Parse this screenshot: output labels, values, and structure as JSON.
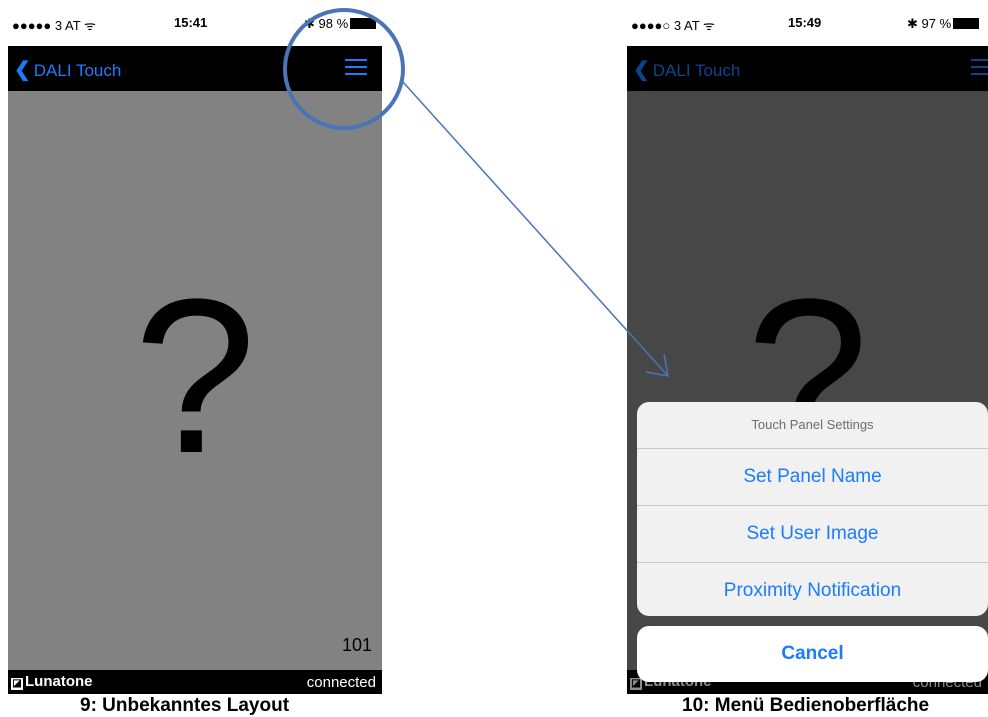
{
  "left_screen": {
    "status": {
      "carrier": "●●●●● 3 AT ᯤ",
      "time": "15:41",
      "battery": "✱ 98 %"
    },
    "nav": {
      "back_label": "DALI Touch"
    },
    "content": {
      "symbol": "?",
      "number": "101"
    },
    "footer": {
      "logo": "Lunatone",
      "status": "connected"
    },
    "caption": "9: Unbekanntes Layout"
  },
  "right_screen": {
    "status": {
      "carrier": "●●●●○ 3 AT ᯤ",
      "time": "15:49",
      "battery": "✱ 97 %"
    },
    "nav": {
      "back_label": "DALI Touch"
    },
    "content": {
      "symbol": "?"
    },
    "footer": {
      "logo": "Lunatone",
      "status": "connected"
    },
    "action_sheet": {
      "title": "Touch Panel Settings",
      "options": [
        "Set Panel Name",
        "Set User Image",
        "Proximity Notification"
      ],
      "cancel": "Cancel"
    },
    "caption": "10: Menü Bedienoberfläche"
  },
  "colors": {
    "accent": "#1a7cff",
    "annotation": "#4a74b4",
    "content_bg": "#828282"
  }
}
